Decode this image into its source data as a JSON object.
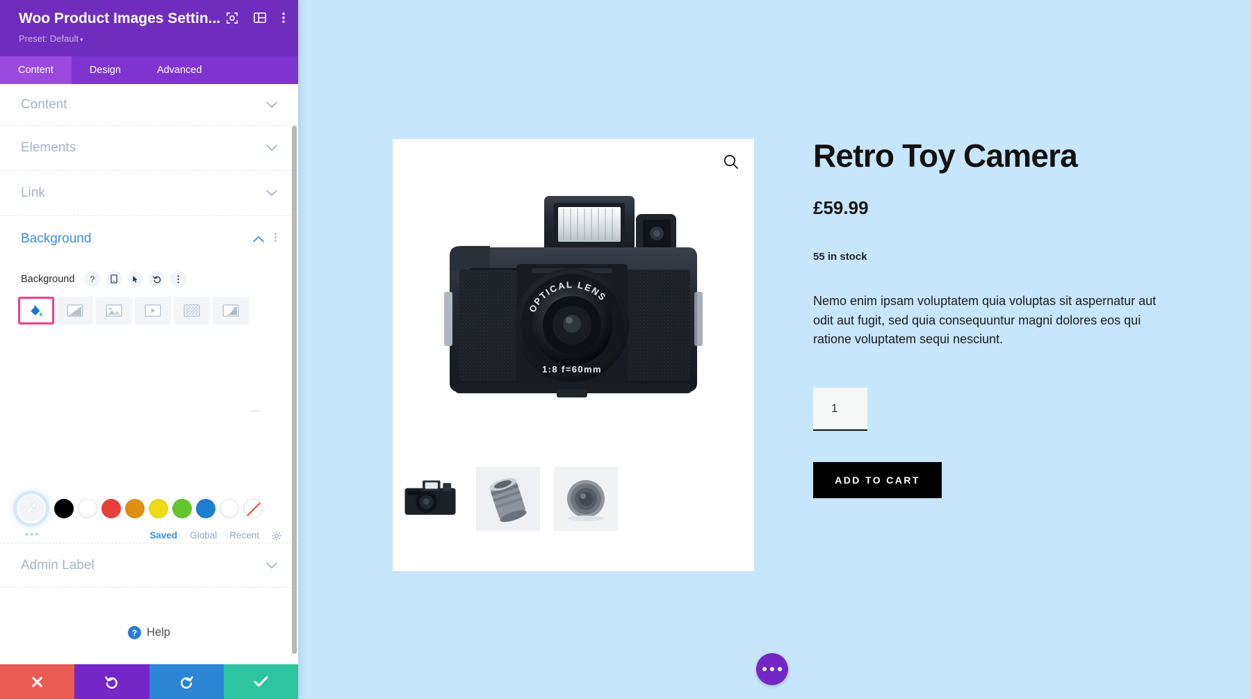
{
  "panel": {
    "title": "Woo Product Images Settin...",
    "preset_label": "Preset: Default",
    "preset_caret": "▾",
    "header_icons": [
      {
        "name": "focus-target-icon",
        "glyph": "⟦⦿⟧"
      },
      {
        "name": "panel-layout-icon",
        "glyph": "▤"
      },
      {
        "name": "kebab-menu-icon",
        "glyph": "⋮"
      }
    ],
    "tabs": [
      {
        "label": "Content",
        "active": true
      },
      {
        "label": "Design",
        "active": false
      },
      {
        "label": "Advanced",
        "active": false
      }
    ],
    "sections": [
      {
        "label": "Content",
        "open": false,
        "chevron": "⌄"
      },
      {
        "label": "Elements",
        "open": false,
        "chevron": "⌄"
      },
      {
        "label": "Link",
        "open": false,
        "chevron": "⌄"
      },
      {
        "label": "Background",
        "open": true,
        "chevron": "⌃",
        "kebab": "⋮"
      },
      {
        "label": "Admin Label",
        "open": false,
        "chevron": "⌄"
      }
    ],
    "background": {
      "field_label": "Background",
      "field_controls": [
        {
          "name": "help-icon",
          "glyph": "?"
        },
        {
          "name": "responsive-mobile-icon",
          "glyph": "▯"
        },
        {
          "name": "hover-cursor-icon",
          "glyph": "➤"
        },
        {
          "name": "reset-undo-icon",
          "glyph": "↺"
        },
        {
          "name": "options-kebab-icon",
          "glyph": "⋮"
        }
      ],
      "types": [
        {
          "name": "background-color-tab",
          "icon": "paint-bucket-icon",
          "selected": true
        },
        {
          "name": "background-gradient-tab",
          "icon": "gradient-icon",
          "selected": false
        },
        {
          "name": "background-image-tab",
          "icon": "image-icon",
          "selected": false
        },
        {
          "name": "background-video-tab",
          "icon": "video-play-icon",
          "selected": false
        },
        {
          "name": "background-pattern-tab",
          "icon": "pattern-grid-icon",
          "selected": false
        },
        {
          "name": "background-mask-tab",
          "icon": "mask-shape-icon",
          "selected": false
        }
      ]
    },
    "palette": {
      "eyedropper_icon": "eyedropper-icon",
      "more_dots": "•••",
      "swatches": [
        {
          "name": "swatch-black",
          "color": "#000000"
        },
        {
          "name": "swatch-white",
          "color": "#ffffff"
        },
        {
          "name": "swatch-red",
          "color": "#e8413c"
        },
        {
          "name": "swatch-orange",
          "color": "#df8f12"
        },
        {
          "name": "swatch-yellow",
          "color": "#eddc14"
        },
        {
          "name": "swatch-green",
          "color": "#64c52a"
        },
        {
          "name": "swatch-blue",
          "color": "#1d7fd1"
        },
        {
          "name": "swatch-white-2",
          "color": "#ffffff"
        },
        {
          "name": "swatch-transparent",
          "color": "transparent"
        }
      ],
      "tabs": [
        {
          "label": "Saved",
          "active": true
        },
        {
          "label": "Global",
          "active": false
        },
        {
          "label": "Recent",
          "active": false
        }
      ],
      "gear_icon": "gear-icon"
    },
    "help": {
      "label": "Help",
      "icon_glyph": "?"
    },
    "actions": [
      {
        "name": "cancel-button",
        "icon": "close-x-icon",
        "glyph": "✕",
        "color": "#ea5b53"
      },
      {
        "name": "undo-button",
        "icon": "undo-arrow-icon",
        "glyph": "↺",
        "color": "#7427c6"
      },
      {
        "name": "redo-button",
        "icon": "redo-arrow-icon",
        "glyph": "↻",
        "color": "#2b84d4"
      },
      {
        "name": "save-button",
        "icon": "check-icon",
        "glyph": "✓",
        "color": "#2fc4a0"
      }
    ]
  },
  "canvas": {
    "background_color": "#c7e6fb",
    "gallery": {
      "zoom_icon": "magnifier-icon",
      "main_image_alt": "Retro Toy Camera",
      "thumbnails": [
        {
          "name": "thumbnail-camera",
          "alt": "Retro Toy Camera"
        },
        {
          "name": "thumbnail-lens-angled",
          "alt": "Camera lens angled"
        },
        {
          "name": "thumbnail-lens-front",
          "alt": "Camera lens front"
        }
      ]
    },
    "product": {
      "title": "Retro Toy Camera",
      "price": "£59.99",
      "stock": "55 in stock",
      "description": "Nemo enim ipsam voluptatem quia voluptas sit aspernatur aut odit aut fugit, sed quia consequuntur magni dolores eos qui ratione voluptatem sequi nesciunt.",
      "quantity": "1",
      "add_to_cart_label": "ADD TO CART"
    },
    "fab": {
      "name": "page-settings-fab",
      "icon": "ellipsis-icon"
    }
  }
}
